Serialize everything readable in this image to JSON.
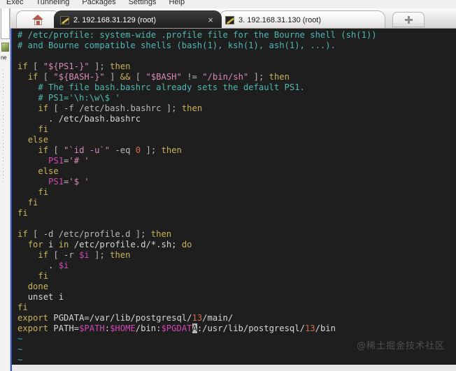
{
  "menubar": {
    "items": [
      "Exec",
      "Tunneling",
      "Packages",
      "Settings",
      "Help"
    ]
  },
  "dock": {
    "label": "ne",
    "icon": "globe-icon"
  },
  "tabs": {
    "home_icon": "home-icon",
    "new_tab_icon": "plus-icon",
    "items": [
      {
        "label": "2. 192.168.31.129 (root)",
        "active": true,
        "close": "×",
        "icon": "terminal-icon"
      },
      {
        "label": "3. 192.168.31.130 (root)",
        "active": false,
        "close": "",
        "icon": "terminal-icon"
      }
    ]
  },
  "watermark": "@稀土掘金技术社区",
  "colors": {
    "terminal_bg": "#1e1e1e",
    "accent_blue": "#3355cc",
    "comment": "#4fb8b0",
    "keyword": "#c9b458",
    "string": "#d98ab8",
    "variable": "#d148b3",
    "number": "#d66a4f",
    "plain": "#d7d7d7",
    "tilde": "#3f9ec6",
    "cursor": "#b8b8b8"
  },
  "terminal": {
    "file": "/etc/profile",
    "cursor_char": "A",
    "lines": [
      [
        {
          "t": "# /etc/profile: system-wide .profile file for the Bourne shell (sh(1))",
          "c": "c-comment"
        }
      ],
      [
        {
          "t": "# and Bourne compatible shells (bash(1), ksh(1), ash(1), ...).",
          "c": "c-comment"
        }
      ],
      [
        {
          "t": "",
          "c": "c-plain"
        }
      ],
      [
        {
          "t": "if",
          "c": "c-kw"
        },
        {
          "t": " [ ",
          "c": "c-op"
        },
        {
          "t": "\"${PS1-}\"",
          "c": "c-str"
        },
        {
          "t": " ]; ",
          "c": "c-op"
        },
        {
          "t": "then",
          "c": "c-kw"
        }
      ],
      [
        {
          "t": "  ",
          "c": "c-plain"
        },
        {
          "t": "if",
          "c": "c-kw"
        },
        {
          "t": " [ ",
          "c": "c-op"
        },
        {
          "t": "\"${BASH-}\"",
          "c": "c-str"
        },
        {
          "t": " ] ",
          "c": "c-op"
        },
        {
          "t": "&&",
          "c": "c-kw"
        },
        {
          "t": " [ ",
          "c": "c-op"
        },
        {
          "t": "\"$BASH\"",
          "c": "c-str"
        },
        {
          "t": " != ",
          "c": "c-op"
        },
        {
          "t": "\"/bin/sh\"",
          "c": "c-str"
        },
        {
          "t": " ]; ",
          "c": "c-op"
        },
        {
          "t": "then",
          "c": "c-kw"
        }
      ],
      [
        {
          "t": "    # The file bash.bashrc already sets the default PS1.",
          "c": "c-comment"
        }
      ],
      [
        {
          "t": "    # PS1='\\h:\\w\\$ '",
          "c": "c-comment"
        }
      ],
      [
        {
          "t": "    ",
          "c": "c-plain"
        },
        {
          "t": "if",
          "c": "c-kw"
        },
        {
          "t": " [ -f /etc/bash.bashrc ]; ",
          "c": "c-op"
        },
        {
          "t": "then",
          "c": "c-kw"
        }
      ],
      [
        {
          "t": "      . /etc/bash.bashrc",
          "c": "c-plain"
        }
      ],
      [
        {
          "t": "    ",
          "c": "c-plain"
        },
        {
          "t": "fi",
          "c": "c-kw"
        }
      ],
      [
        {
          "t": "  ",
          "c": "c-plain"
        },
        {
          "t": "else",
          "c": "c-kw"
        }
      ],
      [
        {
          "t": "    ",
          "c": "c-plain"
        },
        {
          "t": "if",
          "c": "c-kw"
        },
        {
          "t": " [ ",
          "c": "c-op"
        },
        {
          "t": "\"`id -u`\"",
          "c": "c-str"
        },
        {
          "t": " -eq ",
          "c": "c-op"
        },
        {
          "t": "0",
          "c": "c-num"
        },
        {
          "t": " ]; ",
          "c": "c-op"
        },
        {
          "t": "then",
          "c": "c-kw"
        }
      ],
      [
        {
          "t": "      ",
          "c": "c-plain"
        },
        {
          "t": "PS1",
          "c": "c-var"
        },
        {
          "t": "=",
          "c": "c-op"
        },
        {
          "t": "'# '",
          "c": "c-str"
        }
      ],
      [
        {
          "t": "    ",
          "c": "c-plain"
        },
        {
          "t": "else",
          "c": "c-kw"
        }
      ],
      [
        {
          "t": "      ",
          "c": "c-plain"
        },
        {
          "t": "PS1",
          "c": "c-var"
        },
        {
          "t": "=",
          "c": "c-op"
        },
        {
          "t": "'$ '",
          "c": "c-str"
        }
      ],
      [
        {
          "t": "    ",
          "c": "c-plain"
        },
        {
          "t": "fi",
          "c": "c-kw"
        }
      ],
      [
        {
          "t": "  ",
          "c": "c-plain"
        },
        {
          "t": "fi",
          "c": "c-kw"
        }
      ],
      [
        {
          "t": "fi",
          "c": "c-kw"
        }
      ],
      [
        {
          "t": "",
          "c": "c-plain"
        }
      ],
      [
        {
          "t": "if",
          "c": "c-kw"
        },
        {
          "t": " [ -d /etc/profile.d ]; ",
          "c": "c-op"
        },
        {
          "t": "then",
          "c": "c-kw"
        }
      ],
      [
        {
          "t": "  ",
          "c": "c-plain"
        },
        {
          "t": "for",
          "c": "c-kw"
        },
        {
          "t": " i ",
          "c": "c-plain"
        },
        {
          "t": "in",
          "c": "c-kw"
        },
        {
          "t": " /etc/profile.d/*.sh; ",
          "c": "c-plain"
        },
        {
          "t": "do",
          "c": "c-kw"
        }
      ],
      [
        {
          "t": "    ",
          "c": "c-plain"
        },
        {
          "t": "if",
          "c": "c-kw"
        },
        {
          "t": " [ -r ",
          "c": "c-op"
        },
        {
          "t": "$i",
          "c": "c-var"
        },
        {
          "t": " ]; ",
          "c": "c-op"
        },
        {
          "t": "then",
          "c": "c-kw"
        }
      ],
      [
        {
          "t": "      . ",
          "c": "c-plain"
        },
        {
          "t": "$i",
          "c": "c-var"
        }
      ],
      [
        {
          "t": "    ",
          "c": "c-plain"
        },
        {
          "t": "fi",
          "c": "c-kw"
        }
      ],
      [
        {
          "t": "  ",
          "c": "c-plain"
        },
        {
          "t": "done",
          "c": "c-kw"
        }
      ],
      [
        {
          "t": "  ",
          "c": "c-plain"
        },
        {
          "t": "unset",
          "c": "c-plain"
        },
        {
          "t": " i",
          "c": "c-plain"
        }
      ],
      [
        {
          "t": "fi",
          "c": "c-kw"
        }
      ],
      [
        {
          "t": "export",
          "c": "c-kw"
        },
        {
          "t": " PGDATA=/var/lib/postgresql/",
          "c": "c-plain"
        },
        {
          "t": "13",
          "c": "c-num"
        },
        {
          "t": "/main/",
          "c": "c-plain"
        }
      ],
      [
        {
          "t": "export",
          "c": "c-kw"
        },
        {
          "t": " PATH=",
          "c": "c-plain"
        },
        {
          "t": "$PATH",
          "c": "c-var"
        },
        {
          "t": ":",
          "c": "c-plain"
        },
        {
          "t": "$HOME",
          "c": "c-var"
        },
        {
          "t": "/bin:",
          "c": "c-plain"
        },
        {
          "t": "$PGDAT",
          "c": "c-var"
        },
        {
          "t": "A",
          "c": "cursor"
        },
        {
          "t": ":/usr/lib/postgresql/",
          "c": "c-plain"
        },
        {
          "t": "13",
          "c": "c-num"
        },
        {
          "t": "/bin",
          "c": "c-plain"
        }
      ],
      [
        {
          "t": "~",
          "c": "c-tilde"
        }
      ],
      [
        {
          "t": "~",
          "c": "c-tilde"
        }
      ],
      [
        {
          "t": "~",
          "c": "c-tilde"
        }
      ]
    ]
  }
}
